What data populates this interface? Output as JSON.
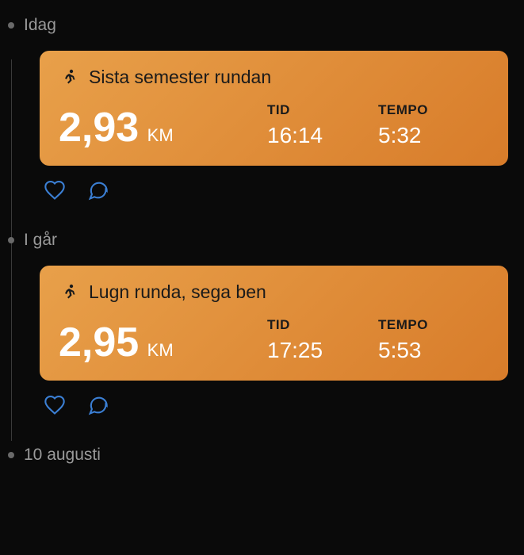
{
  "sections": [
    {
      "date_label": "Idag",
      "activity": {
        "title": "Sista semester rundan",
        "distance_value": "2,93",
        "distance_unit": "KM",
        "time_label": "TID",
        "time_value": "16:14",
        "pace_label": "TEMPO",
        "pace_value": "5:32"
      }
    },
    {
      "date_label": "I går",
      "activity": {
        "title": "Lugn runda, sega ben",
        "distance_value": "2,95",
        "distance_unit": "KM",
        "time_label": "TID",
        "time_value": "17:25",
        "pace_label": "TEMPO",
        "pace_value": "5:53"
      }
    },
    {
      "date_label": "10 augusti"
    }
  ],
  "colors": {
    "card_gradient_start": "#e8a04a",
    "card_gradient_end": "#d87c2a",
    "action_icon": "#3b7fd4"
  }
}
